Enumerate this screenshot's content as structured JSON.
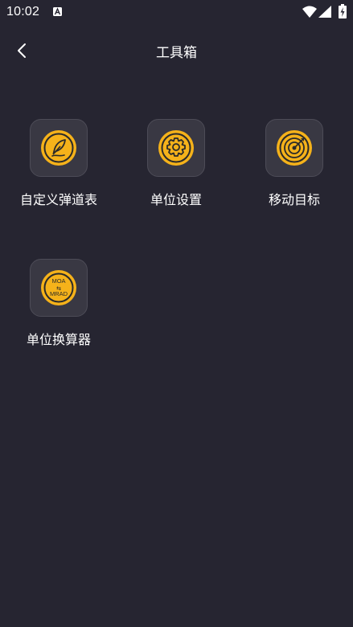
{
  "status_bar": {
    "time": "10:02",
    "icons": [
      "a-notification-icon",
      "wifi-icon",
      "signal-icon",
      "battery-charging-icon"
    ]
  },
  "header": {
    "title": "工具箱",
    "back_icon": "chevron-left-icon"
  },
  "tools": [
    {
      "label": "自定义弹道表",
      "icon": "feather-pen-icon"
    },
    {
      "label": "单位设置",
      "icon": "gear-icon"
    },
    {
      "label": "移动目标",
      "icon": "target-arrow-icon"
    },
    {
      "label": "单位换算器",
      "icon": "moa-mrad-convert-icon",
      "icon_text_top": "MOA",
      "icon_text_mid": "⇆",
      "icon_text_bottom": "MRAD"
    }
  ],
  "colors": {
    "background": "#262531",
    "tile": "#393843",
    "accent": "#F5B21A",
    "icon_dark": "#2a2a2a"
  }
}
